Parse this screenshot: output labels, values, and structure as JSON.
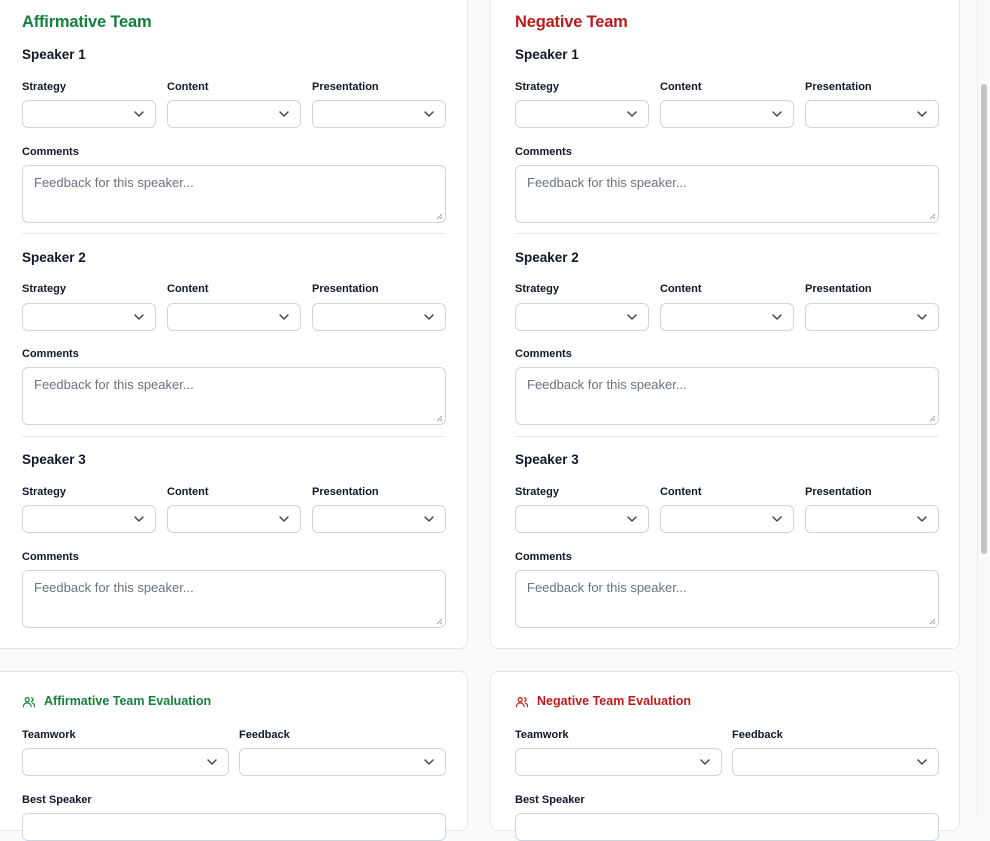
{
  "affirmative": {
    "title": "Affirmative Team",
    "speakers": [
      {
        "title": "Speaker 1",
        "strategy": "Strategy",
        "content": "Content",
        "presentation": "Presentation",
        "comments": "Comments",
        "placeholder": "Feedback for this speaker..."
      },
      {
        "title": "Speaker 2",
        "strategy": "Strategy",
        "content": "Content",
        "presentation": "Presentation",
        "comments": "Comments",
        "placeholder": "Feedback for this speaker..."
      },
      {
        "title": "Speaker 3",
        "strategy": "Strategy",
        "content": "Content",
        "presentation": "Presentation",
        "comments": "Comments",
        "placeholder": "Feedback for this speaker..."
      }
    ]
  },
  "negative": {
    "title": "Negative Team",
    "speakers": [
      {
        "title": "Speaker 1",
        "strategy": "Strategy",
        "content": "Content",
        "presentation": "Presentation",
        "comments": "Comments",
        "placeholder": "Feedback for this speaker..."
      },
      {
        "title": "Speaker 2",
        "strategy": "Strategy",
        "content": "Content",
        "presentation": "Presentation",
        "comments": "Comments",
        "placeholder": "Feedback for this speaker..."
      },
      {
        "title": "Speaker 3",
        "strategy": "Strategy",
        "content": "Content",
        "presentation": "Presentation",
        "comments": "Comments",
        "placeholder": "Feedback for this speaker..."
      }
    ]
  },
  "affirmative_eval": {
    "title": "Affirmative Team Evaluation",
    "teamwork": "Teamwork",
    "feedback": "Feedback",
    "best_speaker": "Best Speaker",
    "icon": "users-icon"
  },
  "negative_eval": {
    "title": "Negative Team Evaluation",
    "teamwork": "Teamwork",
    "feedback": "Feedback",
    "best_speaker": "Best Speaker",
    "icon": "users-icon"
  },
  "colors": {
    "affirmative": "#15803d",
    "negative": "#b91c1c",
    "border": "#d1d5db",
    "placeholder": "#6b7280"
  }
}
